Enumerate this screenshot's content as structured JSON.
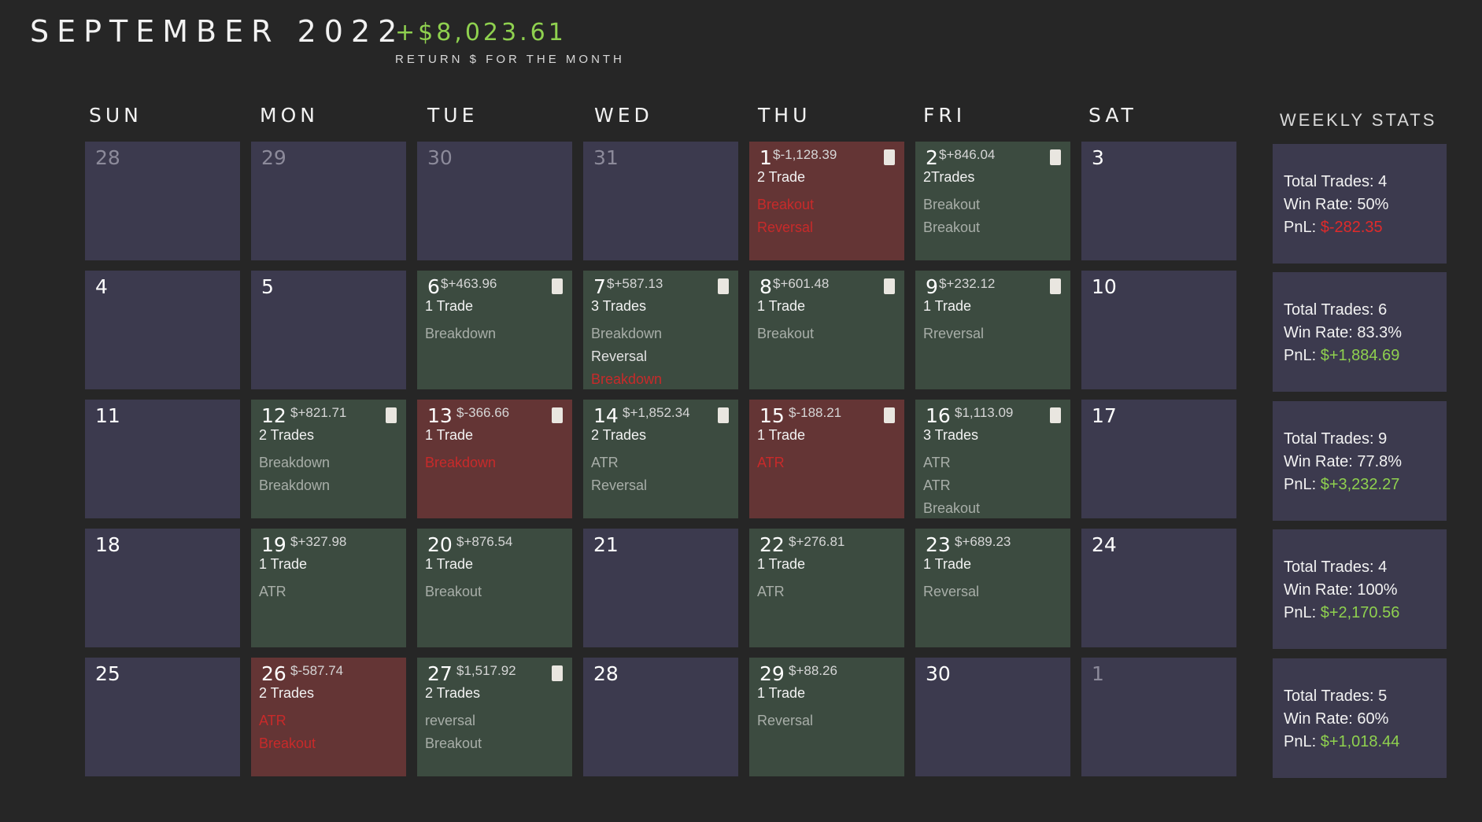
{
  "header": {
    "title": "SEPTEMBER 2022",
    "month_return": "+$8,023.61",
    "month_return_label": "RETURN $ FOR THE MONTH"
  },
  "days_of_week": [
    "SUN",
    "MON",
    "TUE",
    "WED",
    "THU",
    "FRI",
    "SAT"
  ],
  "weekly_stats_title": "WEEKLY STATS",
  "labels": {
    "total_trades": "Total Trades: ",
    "win_rate": "Win Rate: ",
    "pnl": "PnL: "
  },
  "colors": {
    "background": "#262626",
    "empty_cell": "#3c3a4e",
    "win_cell": "#3c4b40",
    "loss_cell": "#643535",
    "positive": "#8fd14f",
    "negative": "#e02a2a"
  },
  "weeks": [
    {
      "days": [
        {
          "day": "28",
          "type": "muted"
        },
        {
          "day": "29",
          "type": "muted"
        },
        {
          "day": "30",
          "type": "muted"
        },
        {
          "day": "31",
          "type": "muted"
        },
        {
          "day": "1",
          "type": "loss",
          "pnl": "$-1,128.39",
          "note": true,
          "trades": "2 Trade",
          "setups": [
            {
              "t": "Breakout",
              "c": "red"
            },
            {
              "t": "Reversal",
              "c": "red"
            }
          ]
        },
        {
          "day": "2",
          "type": "win",
          "pnl": "$+846.04",
          "note": true,
          "trades": "2Trades",
          "setups": [
            {
              "t": "Breakout",
              "c": "grey"
            },
            {
              "t": "Breakout",
              "c": "grey"
            }
          ]
        },
        {
          "day": "3",
          "type": "empty"
        }
      ],
      "stats": {
        "trades": "4",
        "win_rate": "50%",
        "pnl": "$-282.35",
        "sign": "neg"
      }
    },
    {
      "days": [
        {
          "day": "4",
          "type": "empty"
        },
        {
          "day": "5",
          "type": "empty"
        },
        {
          "day": "6",
          "type": "win",
          "pnl": "$+463.96",
          "note": true,
          "trades": "1 Trade",
          "setups": [
            {
              "t": "Breakdown",
              "c": "grey"
            }
          ]
        },
        {
          "day": "7",
          "type": "win",
          "pnl": "$+587.13",
          "note": true,
          "trades": "3 Trades",
          "setups": [
            {
              "t": "Breakdown",
              "c": "grey"
            },
            {
              "t": "Reversal",
              "c": "bright"
            },
            {
              "t": "Breakdown",
              "c": "red"
            }
          ]
        },
        {
          "day": "8",
          "type": "win",
          "pnl": "$+601.48",
          "note": true,
          "trades": "1 Trade",
          "setups": [
            {
              "t": "Breakout",
              "c": "grey"
            }
          ]
        },
        {
          "day": "9",
          "type": "win",
          "pnl": "$+232.12",
          "note": true,
          "trades": "1 Trade",
          "setups": [
            {
              "t": "Rreversal",
              "c": "grey"
            }
          ]
        },
        {
          "day": "10",
          "type": "empty"
        }
      ],
      "stats": {
        "trades": "6",
        "win_rate": "83.3%",
        "pnl": "$+1,884.69",
        "sign": "pos"
      }
    },
    {
      "days": [
        {
          "day": "11",
          "type": "empty"
        },
        {
          "day": "12",
          "type": "win",
          "pnl": "$+821.71",
          "note": true,
          "trades": "2 Trades",
          "setups": [
            {
              "t": "Breakdown",
              "c": "grey"
            },
            {
              "t": "Breakdown",
              "c": "grey"
            }
          ]
        },
        {
          "day": "13",
          "type": "loss",
          "pnl": "$-366.66",
          "note": true,
          "trades": "1 Trade",
          "setups": [
            {
              "t": "Breakdown",
              "c": "red"
            }
          ]
        },
        {
          "day": "14",
          "type": "win",
          "pnl": "$+1,852.34",
          "note": true,
          "trades": "2 Trades",
          "setups": [
            {
              "t": "ATR",
              "c": "grey"
            },
            {
              "t": "Reversal",
              "c": "grey"
            }
          ]
        },
        {
          "day": "15",
          "type": "loss",
          "pnl": "$-188.21",
          "note": true,
          "trades": "1 Trade",
          "setups": [
            {
              "t": "ATR",
              "c": "red"
            }
          ]
        },
        {
          "day": "16",
          "type": "win",
          "pnl": "$1,113.09",
          "note": true,
          "trades": "3 Trades",
          "setups": [
            {
              "t": "ATR",
              "c": "grey"
            },
            {
              "t": "ATR",
              "c": "grey"
            },
            {
              "t": "Breakout",
              "c": "grey"
            }
          ]
        },
        {
          "day": "17",
          "type": "empty"
        }
      ],
      "stats": {
        "trades": "9",
        "win_rate": "77.8%",
        "pnl": "$+3,232.27",
        "sign": "pos"
      }
    },
    {
      "days": [
        {
          "day": "18",
          "type": "empty"
        },
        {
          "day": "19",
          "type": "win",
          "pnl": "$+327.98",
          "note": false,
          "trades": "1 Trade",
          "setups": [
            {
              "t": "ATR",
              "c": "grey"
            }
          ]
        },
        {
          "day": "20",
          "type": "win",
          "pnl": "$+876.54",
          "note": false,
          "trades": "1 Trade",
          "setups": [
            {
              "t": "Breakout",
              "c": "grey"
            }
          ]
        },
        {
          "day": "21",
          "type": "empty"
        },
        {
          "day": "22",
          "type": "win",
          "pnl": "$+276.81",
          "note": false,
          "trades": "1 Trade",
          "setups": [
            {
              "t": "ATR",
              "c": "grey"
            }
          ]
        },
        {
          "day": "23",
          "type": "win",
          "pnl": "$+689.23",
          "note": false,
          "trades": "1 Trade",
          "setups": [
            {
              "t": "Reversal",
              "c": "grey"
            }
          ]
        },
        {
          "day": "24",
          "type": "empty"
        }
      ],
      "stats": {
        "trades": "4",
        "win_rate": "100%",
        "pnl": "$+2,170.56",
        "sign": "pos"
      }
    },
    {
      "days": [
        {
          "day": "25",
          "type": "empty"
        },
        {
          "day": "26",
          "type": "loss",
          "pnl": "$-587.74",
          "note": false,
          "trades": "2 Trades",
          "setups": [
            {
              "t": "ATR",
              "c": "red"
            },
            {
              "t": "Breakout",
              "c": "red"
            }
          ]
        },
        {
          "day": "27",
          "type": "win",
          "pnl": "$1,517.92",
          "note": true,
          "trades": "2 Trades",
          "setups": [
            {
              "t": "reversal",
              "c": "grey"
            },
            {
              "t": "Breakout",
              "c": "grey"
            }
          ]
        },
        {
          "day": "28",
          "type": "empty"
        },
        {
          "day": "29",
          "type": "win",
          "pnl": "$+88.26",
          "note": false,
          "trades": "1 Trade",
          "setups": [
            {
              "t": "Reversal",
              "c": "grey"
            }
          ]
        },
        {
          "day": "30",
          "type": "empty"
        },
        {
          "day": "1",
          "type": "muted"
        }
      ],
      "stats": {
        "trades": "5",
        "win_rate": "60%",
        "pnl": "$+1,018.44",
        "sign": "pos"
      }
    }
  ]
}
